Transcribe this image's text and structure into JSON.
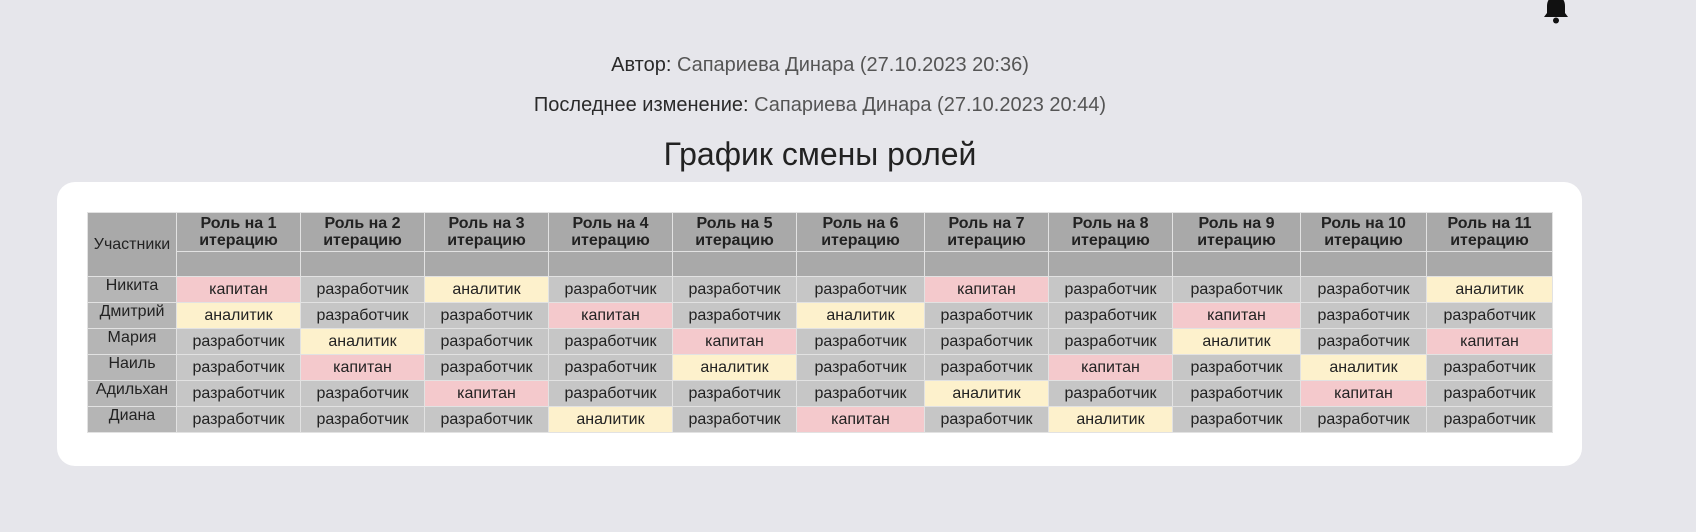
{
  "header": {
    "author_label": "Автор:",
    "author_value": "Сапариева Динара (27.10.2023 20:36)",
    "modified_label": "Последнее изменение:",
    "modified_value": "Сапариева Динара (27.10.2023 20:44)",
    "notification_icon": "bell-icon"
  },
  "page": {
    "title": "График смены ролей"
  },
  "table": {
    "corner_label": "Участники",
    "columns": [
      "Роль на 1 итерацию",
      "Роль на 2 итерацию",
      "Роль на 3 итерацию",
      "Роль на 4 итерацию",
      "Роль на 5 итерацию",
      "Роль на 6 итерацию",
      "Роль на 7 итерацию",
      "Роль на 8 итерацию",
      "Роль на 9 итерацию",
      "Роль на 10 итерацию",
      "Роль на 11 итерацию"
    ],
    "rows": [
      {
        "name": "Никита",
        "roles": [
          "капитан",
          "разработчик",
          "аналитик",
          "разработчик",
          "разработчик",
          "разработчик",
          "капитан",
          "разработчик",
          "разработчик",
          "разработчик",
          "аналитик"
        ]
      },
      {
        "name": "Дмитрий",
        "roles": [
          "аналитик",
          "разработчик",
          "разработчик",
          "капитан",
          "разработчик",
          "аналитик",
          "разработчик",
          "разработчик",
          "капитан",
          "разработчик",
          "разработчик"
        ]
      },
      {
        "name": "Мария",
        "roles": [
          "разработчик",
          "аналитик",
          "разработчик",
          "разработчик",
          "капитан",
          "разработчик",
          "разработчик",
          "разработчик",
          "аналитик",
          "разработчик",
          "капитан"
        ]
      },
      {
        "name": "Наиль",
        "roles": [
          "разработчик",
          "капитан",
          "разработчик",
          "разработчик",
          "аналитик",
          "разработчик",
          "разработчик",
          "капитан",
          "разработчик",
          "аналитик",
          "разработчик"
        ]
      },
      {
        "name": "Адильхан",
        "roles": [
          "разработчик",
          "разработчик",
          "капитан",
          "разработчик",
          "разработчик",
          "разработчик",
          "аналитик",
          "разработчик",
          "разработчик",
          "капитан",
          "разработчик"
        ]
      },
      {
        "name": "Диана",
        "roles": [
          "разработчик",
          "разработчик",
          "разработчик",
          "аналитик",
          "разработчик",
          "капитан",
          "разработчик",
          "аналитик",
          "разработчик",
          "разработчик",
          "разработчик"
        ]
      }
    ],
    "role_colors": {
      "капитан": "#f4c9cc",
      "аналитик": "#fdf1cc",
      "разработчик": "#c6c6c6"
    }
  }
}
